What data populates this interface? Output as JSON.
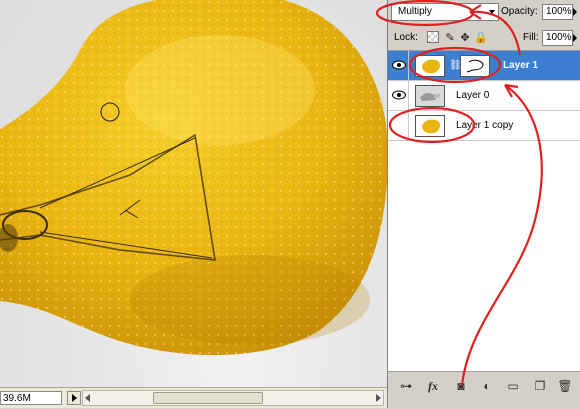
{
  "canvas": {
    "image_label": "lightbulb photo"
  },
  "statusbar": {
    "doc_size": "39.6M"
  },
  "layers_panel": {
    "blend_mode": "Multiply",
    "opacity_label": "Opacity:",
    "opacity_value": "100%",
    "lock_label": "Lock:",
    "fill_label": "Fill:",
    "fill_value": "100%",
    "layers": [
      {
        "name": "Layer 1",
        "selected": true,
        "visible": true,
        "has_mask": true
      },
      {
        "name": "Layer 0",
        "selected": false,
        "visible": true,
        "has_mask": false
      },
      {
        "name": "Layer 1 copy",
        "selected": false,
        "visible": false,
        "has_mask": false
      }
    ],
    "bottom_icons": [
      "link-icon",
      "fx-icon",
      "add-mask-icon",
      "adjustment-layer-icon",
      "new-group-icon",
      "new-layer-icon",
      "trash-icon"
    ]
  },
  "colors": {
    "annotation": "#e02020",
    "selected_layer": "#3c7fd1",
    "bulb": "#e7b20e"
  }
}
